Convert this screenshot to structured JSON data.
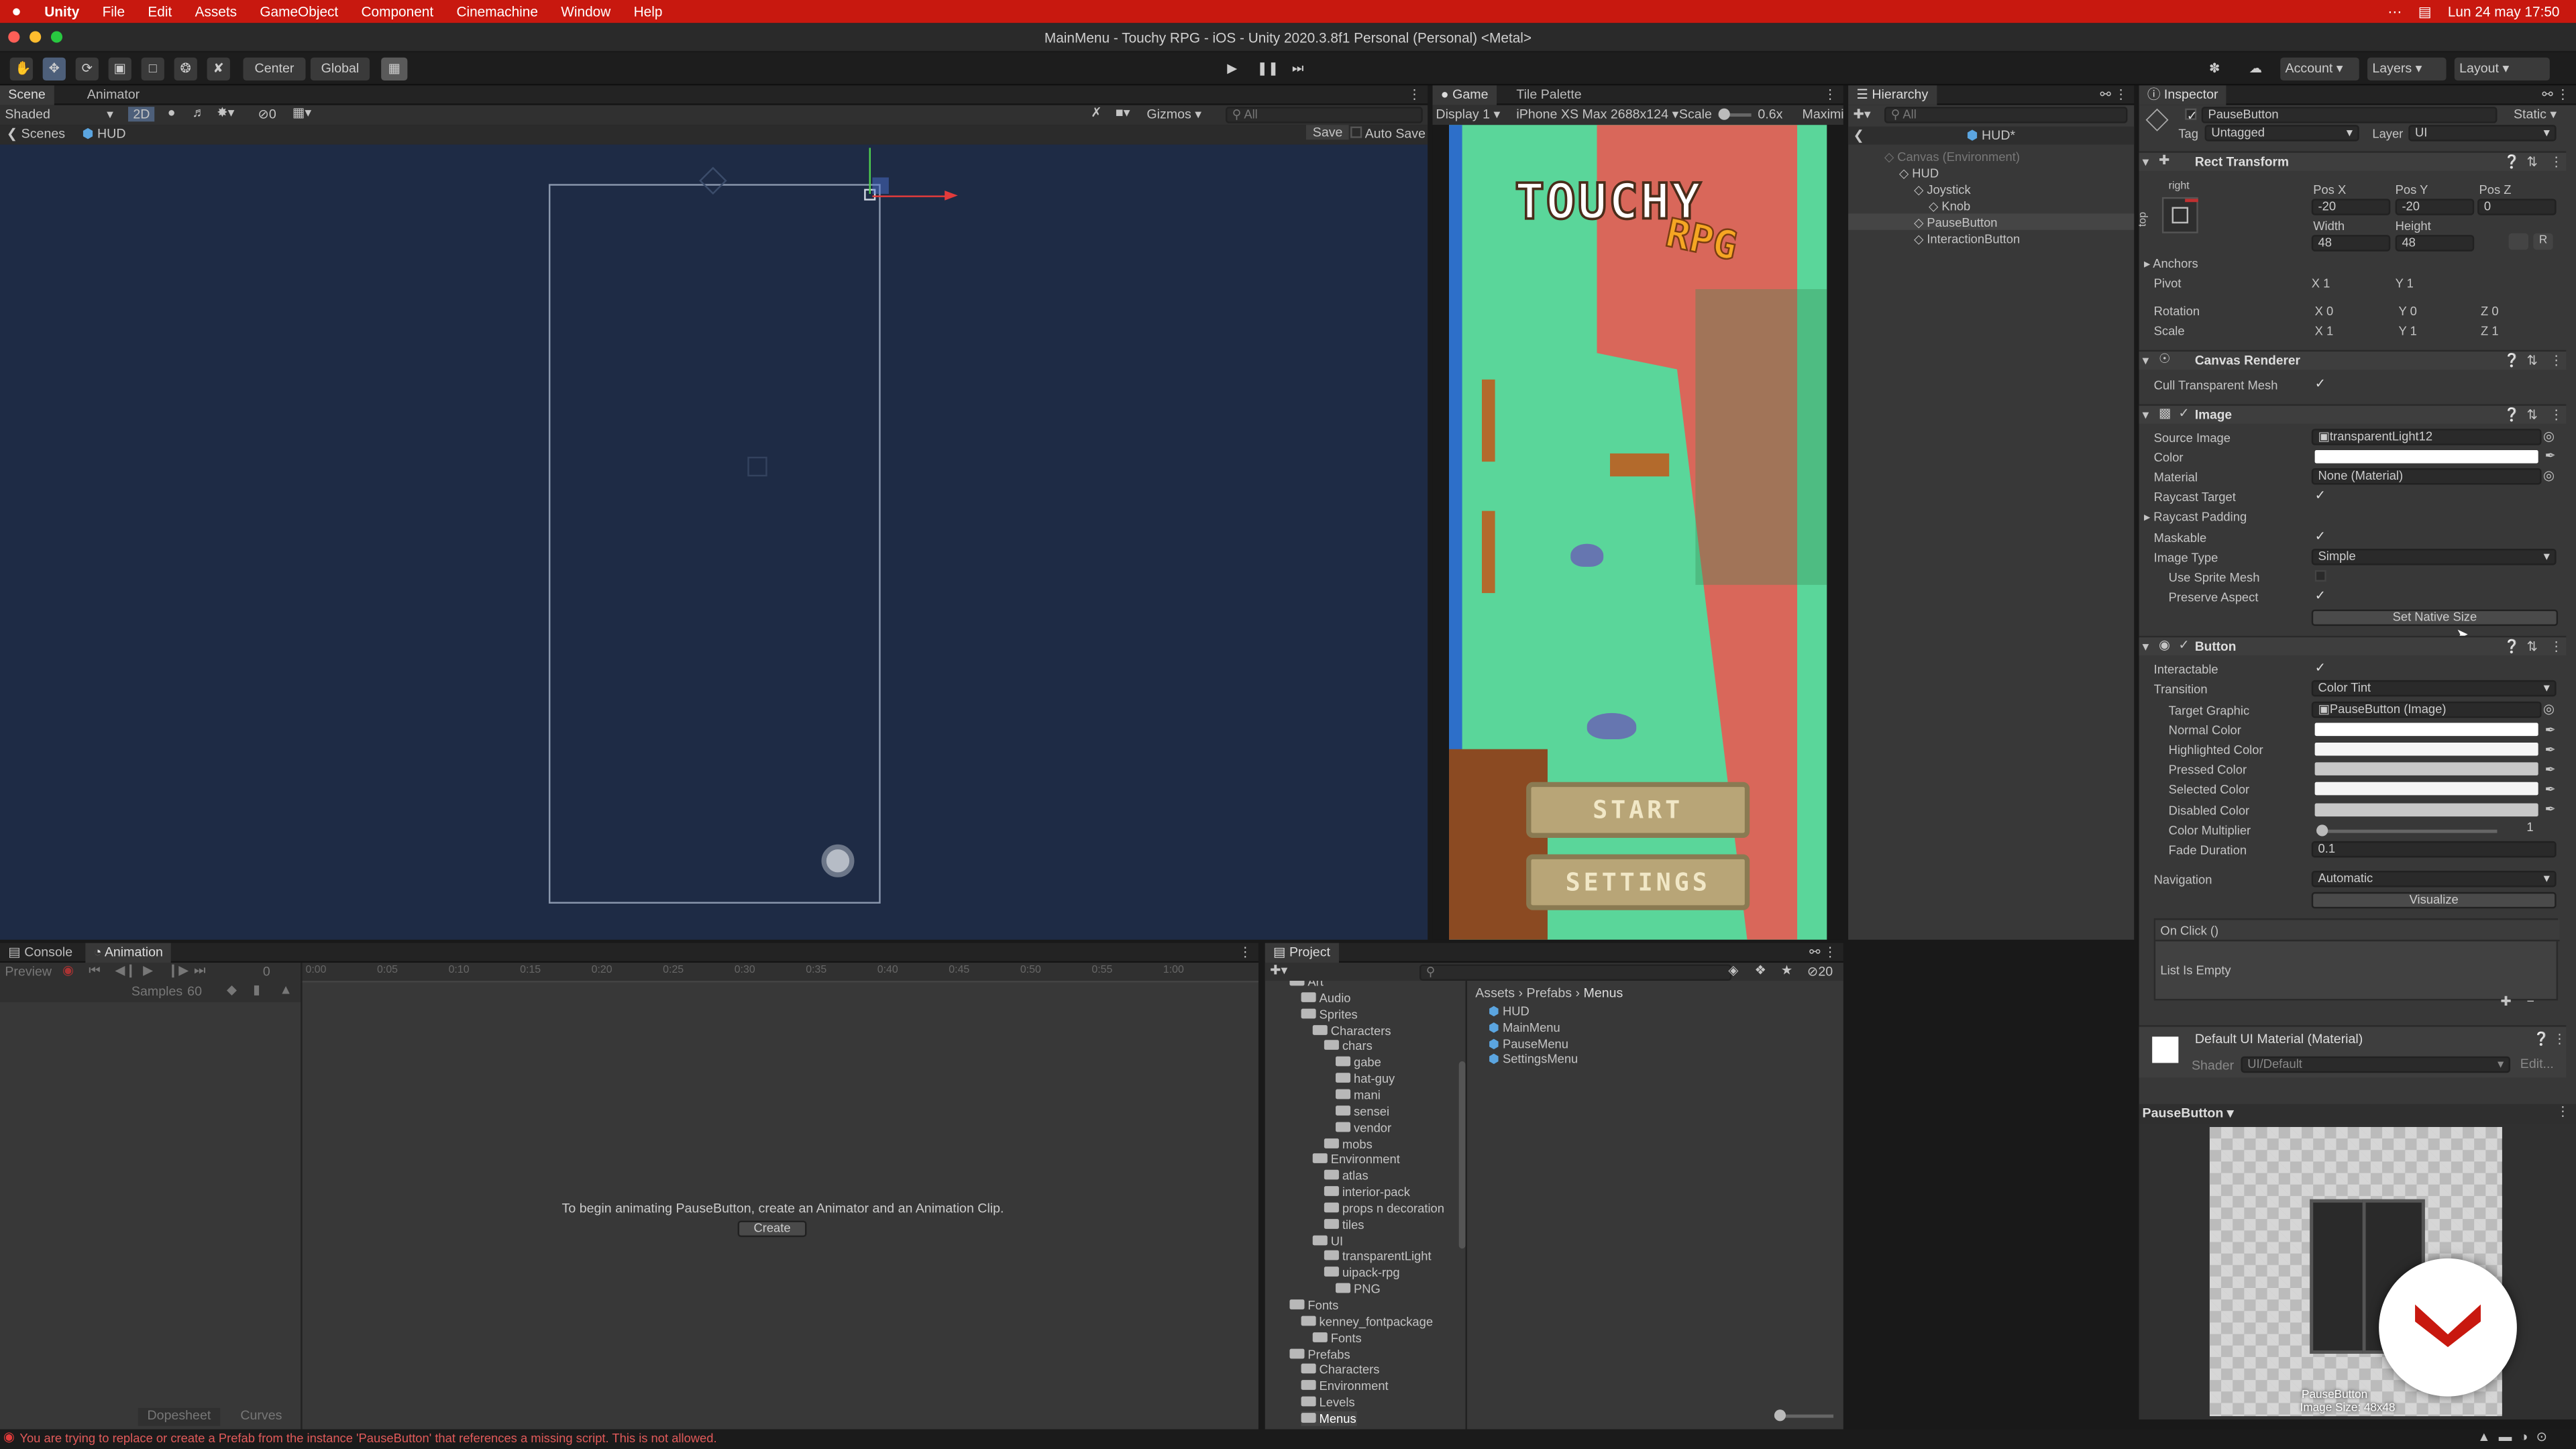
{
  "menubar": {
    "app": "Unity",
    "items": [
      "File",
      "Edit",
      "Assets",
      "GameObject",
      "Component",
      "Cinemachine",
      "Window",
      "Help"
    ],
    "clock": "Lun 24 may  17:50"
  },
  "title": "MainMenu - Touchy RPG - iOS - Unity 2020.3.8f1 Personal (Personal) <Metal>",
  "toolbar": {
    "center": "Center",
    "global": "Global",
    "account": "Account",
    "layers": "Layers",
    "layout": "Layout"
  },
  "scene": {
    "tabs": [
      "Scene",
      "Animator"
    ],
    "shading": "Shaded",
    "mode2d": "2D",
    "gizmos": "Gizmos",
    "search_placeholder": "All",
    "breadcrumb_scenes": "Scenes",
    "breadcrumb_hud": "HUD",
    "save": "Save",
    "autosave": "Auto Save",
    "hidden": "0"
  },
  "game": {
    "tabs": [
      "Game",
      "Tile Palette"
    ],
    "display": "Display 1",
    "device": "iPhone XS Max 2688x124",
    "scale_label": "Scale",
    "scale_value": "0.6x",
    "maximize": "Maximi",
    "logo1": "TOUCHY",
    "logo2": "RPG",
    "btn_start": "START",
    "btn_settings": "SETTINGS"
  },
  "hierarchy": {
    "tab": "Hierarchy",
    "search_placeholder": "All",
    "root": "HUD*",
    "items": [
      {
        "label": "Canvas (Environment)",
        "indent": 0,
        "dim": true
      },
      {
        "label": "HUD",
        "indent": 1
      },
      {
        "label": "Joystick",
        "indent": 2
      },
      {
        "label": "Knob",
        "indent": 3
      },
      {
        "label": "PauseButton",
        "indent": 2,
        "selected": true
      },
      {
        "label": "InteractionButton",
        "indent": 2
      }
    ]
  },
  "inspector": {
    "tab": "Inspector",
    "object": "PauseButton",
    "static": "Static",
    "tag_label": "Tag",
    "tag": "Untagged",
    "layer_label": "Layer",
    "layer": "UI",
    "rect": {
      "title": "Rect Transform",
      "anchor_h": "right",
      "anchor_v": "top",
      "posx_l": "Pos X",
      "posy_l": "Pos Y",
      "posz_l": "Pos Z",
      "posx": "-20",
      "posy": "-20",
      "posz": "0",
      "w_l": "Width",
      "h_l": "Height",
      "w": "48",
      "h": "48",
      "anchors": "Anchors",
      "pivot": "Pivot",
      "rotation": "Rotation",
      "scale": "Scale",
      "pivot_x": "1",
      "pivot_y": "1",
      "rot_x": "0",
      "rot_y": "0",
      "rot_z": "0",
      "sc_x": "1",
      "sc_y": "1",
      "sc_z": "1"
    },
    "canvasrenderer": {
      "title": "Canvas Renderer",
      "cull": "Cull Transparent Mesh"
    },
    "image": {
      "title": "Image",
      "source_l": "Source Image",
      "source": "transparentLight12",
      "color_l": "Color",
      "material_l": "Material",
      "material": "None (Material)",
      "raycast_l": "Raycast Target",
      "padding_l": "Raycast Padding",
      "maskable_l": "Maskable",
      "type_l": "Image Type",
      "type": "Simple",
      "usesprite_l": "Use Sprite Mesh",
      "preserve_l": "Preserve Aspect",
      "native": "Set Native Size"
    },
    "button": {
      "title": "Button",
      "interactable_l": "Interactable",
      "transition_l": "Transition",
      "transition": "Color Tint",
      "target_l": "Target Graphic",
      "target": "PauseButton (Image)",
      "normal_l": "Normal Color",
      "highlighted_l": "Highlighted Color",
      "pressed_l": "Pressed Color",
      "selected_l": "Selected Color",
      "disabled_l": "Disabled Color",
      "multiplier_l": "Color Multiplier",
      "multiplier": "1",
      "fade_l": "Fade Duration",
      "fade": "0.1",
      "nav_l": "Navigation",
      "nav": "Automatic",
      "visualize": "Visualize",
      "onclick": "On Click ()",
      "empty": "List Is Empty"
    },
    "material": {
      "title": "Default UI Material (Material)",
      "shader_l": "Shader",
      "shader": "UI/Default",
      "edit": "Edit..."
    },
    "preview": {
      "title": "PauseButton",
      "caption1": "PauseButton",
      "caption2": "Image Size: 48x48"
    }
  },
  "animation": {
    "tabs": [
      "Console",
      "Animation"
    ],
    "preview": "Preview",
    "frame": "0",
    "samples_l": "Samples",
    "samples": "60",
    "message": "To begin animating PauseButton, create an Animator and an Animation Clip.",
    "create": "Create",
    "dopesheet": "Dopesheet",
    "curves": "Curves",
    "ticks": [
      "0:00",
      "0:05",
      "0:10",
      "0:15",
      "0:20",
      "0:25",
      "0:30",
      "0:35",
      "0:40",
      "0:45",
      "0:50",
      "0:55",
      "1:00"
    ]
  },
  "project": {
    "tab": "Project",
    "count": "20",
    "breadcrumb": [
      "Assets",
      "Prefabs",
      "Menus"
    ],
    "tree": [
      {
        "label": "Art",
        "indent": 1
      },
      {
        "label": "Audio",
        "indent": 2
      },
      {
        "label": "Sprites",
        "indent": 2
      },
      {
        "label": "Characters",
        "indent": 3
      },
      {
        "label": "chars",
        "indent": 4
      },
      {
        "label": "gabe",
        "indent": 5
      },
      {
        "label": "hat-guy",
        "indent": 5
      },
      {
        "label": "mani",
        "indent": 5
      },
      {
        "label": "sensei",
        "indent": 5
      },
      {
        "label": "vendor",
        "indent": 5
      },
      {
        "label": "mobs",
        "indent": 4
      },
      {
        "label": "Environment",
        "indent": 3
      },
      {
        "label": "atlas",
        "indent": 4
      },
      {
        "label": "interior-pack",
        "indent": 4
      },
      {
        "label": "props n decoration",
        "indent": 4
      },
      {
        "label": "tiles",
        "indent": 4
      },
      {
        "label": "UI",
        "indent": 3
      },
      {
        "label": "transparentLight",
        "indent": 4
      },
      {
        "label": "uipack-rpg",
        "indent": 4
      },
      {
        "label": "PNG",
        "indent": 5
      },
      {
        "label": "Fonts",
        "indent": 1
      },
      {
        "label": "kenney_fontpackage",
        "indent": 2
      },
      {
        "label": "Fonts",
        "indent": 3
      },
      {
        "label": "Prefabs",
        "indent": 1
      },
      {
        "label": "Characters",
        "indent": 2
      },
      {
        "label": "Environment",
        "indent": 2
      },
      {
        "label": "Levels",
        "indent": 2
      },
      {
        "label": "Menus",
        "indent": 2,
        "selected": true
      }
    ],
    "files": [
      "HUD",
      "MainMenu",
      "PauseMenu",
      "SettingsMenu"
    ]
  },
  "status": {
    "error": "You are trying to replace or create a Prefab from the instance 'PauseButton' that references a missing script. This is not allowed."
  },
  "colors": {
    "menubar": "#c8180f",
    "accent": "#3a72b0",
    "scene_bg": "#1e2b45",
    "grass": "#5ad69a",
    "path": "#d9675a"
  }
}
